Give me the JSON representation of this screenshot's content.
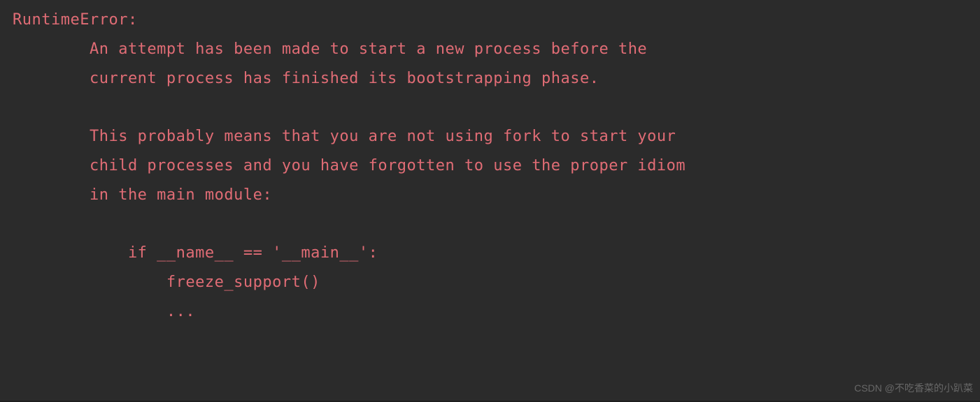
{
  "error": {
    "title": "RuntimeError:",
    "lines": [
      "        An attempt has been made to start a new process before the",
      "        current process has finished its bootstrapping phase.",
      "",
      "        This probably means that you are not using fork to start your",
      "        child processes and you have forgotten to use the proper idiom",
      "        in the main module:",
      "",
      "            if __name__ == '__main__':",
      "                freeze_support()",
      "                ..."
    ]
  },
  "watermark": "CSDN @不吃香菜的小趴菜"
}
